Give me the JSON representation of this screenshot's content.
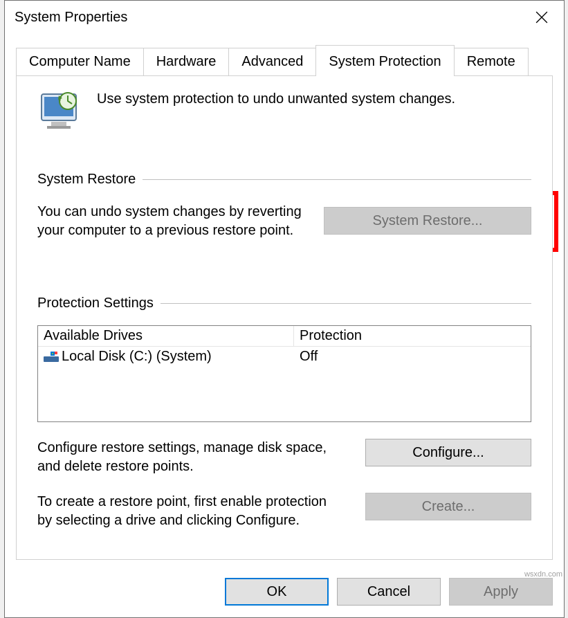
{
  "window": {
    "title": "System Properties"
  },
  "tabs": {
    "items": [
      {
        "label": "Computer Name"
      },
      {
        "label": "Hardware"
      },
      {
        "label": "Advanced"
      },
      {
        "label": "System Protection"
      },
      {
        "label": "Remote"
      }
    ],
    "activeIndex": 3
  },
  "intro": {
    "text": "Use system protection to undo unwanted system changes."
  },
  "systemRestore": {
    "heading": "System Restore",
    "description": "You can undo system changes by reverting your computer to a previous restore point.",
    "button": "System Restore...",
    "buttonEnabled": false
  },
  "protectionSettings": {
    "heading": "Protection Settings",
    "headers": {
      "drives": "Available Drives",
      "protection": "Protection"
    },
    "rows": [
      {
        "name": "Local Disk (C:) (System)",
        "protection": "Off"
      }
    ],
    "configureText": "Configure restore settings, manage disk space, and delete restore points.",
    "configureButton": "Configure...",
    "createText": "To create a restore point, first enable protection by selecting a drive and clicking Configure.",
    "createButton": "Create...",
    "createEnabled": false
  },
  "actions": {
    "ok": "OK",
    "cancel": "Cancel",
    "apply": "Apply",
    "applyEnabled": false
  },
  "watermark": "wsxdn.com"
}
